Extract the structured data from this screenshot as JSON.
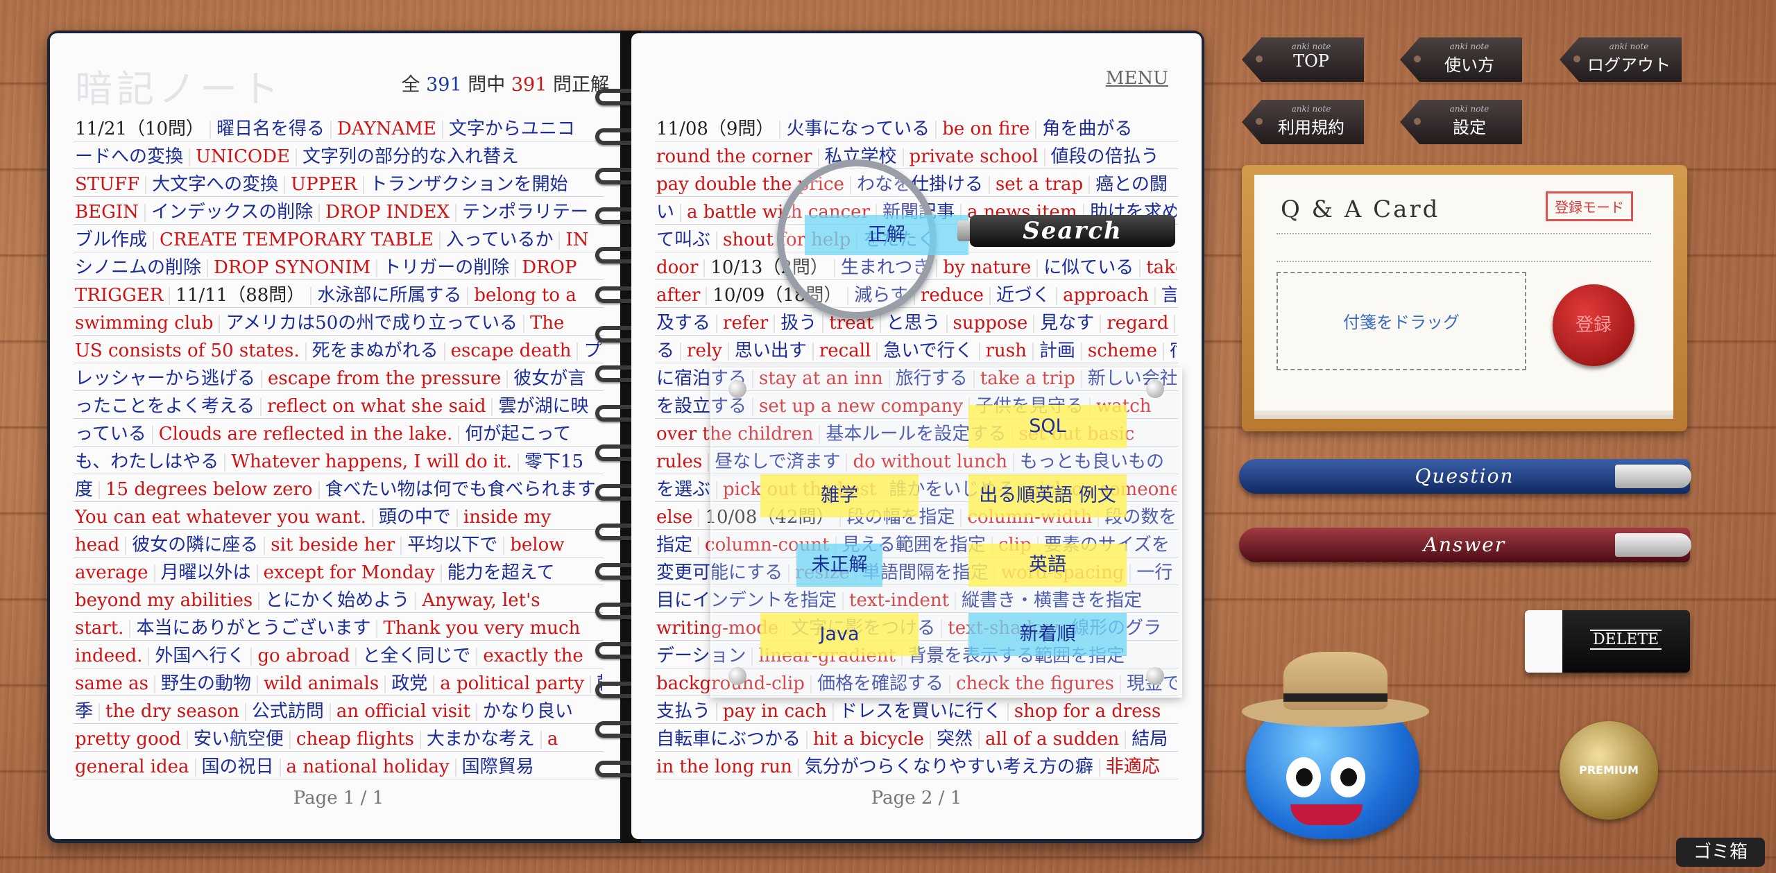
{
  "notebook": {
    "title": "暗記ノート",
    "score": {
      "prefix": "全",
      "total": "391",
      "mid": "問中",
      "correct": "391",
      "suffix": "問正解"
    },
    "menu": "MENU",
    "left_page_label": "Page 1 / 1",
    "right_page_label": "Page 2 / 1",
    "left_lines": [
      [
        [
          "d",
          "11/21（10問）"
        ],
        [
          "q",
          "曜日名を得る"
        ],
        [
          "a",
          "DAYNAME"
        ],
        [
          "q",
          "文字からユニコ"
        ]
      ],
      [
        [
          "q",
          "ードへの変換"
        ],
        [
          "a",
          "UNICODE"
        ],
        [
          "q",
          "文字列の部分的な入れ替え"
        ]
      ],
      [
        [
          "a",
          "STUFF"
        ],
        [
          "q",
          "大文字への変換"
        ],
        [
          "a",
          "UPPER"
        ],
        [
          "q",
          "トランザクションを開始"
        ]
      ],
      [
        [
          "a",
          "BEGIN"
        ],
        [
          "q",
          "インデックスの削除"
        ],
        [
          "a",
          "DROP INDEX"
        ],
        [
          "q",
          "テンポラリテー"
        ]
      ],
      [
        [
          "q",
          "ブル作成"
        ],
        [
          "a",
          "CREATE TEMPORARY TABLE"
        ],
        [
          "q",
          "入っているか"
        ],
        [
          "a",
          "IN"
        ]
      ],
      [
        [
          "q",
          "シノニムの削除"
        ],
        [
          "a",
          "DROP SYNONIM"
        ],
        [
          "q",
          "トリガーの削除"
        ],
        [
          "a",
          "DROP"
        ]
      ],
      [
        [
          "a",
          "TRIGGER"
        ],
        [
          "d",
          "11/11（88問）"
        ],
        [
          "q",
          "水泳部に所属する"
        ],
        [
          "a",
          "belong to a"
        ]
      ],
      [
        [
          "a",
          "swimming club"
        ],
        [
          "q",
          "アメリカは50の州で成り立っている"
        ],
        [
          "a",
          "The"
        ]
      ],
      [
        [
          "a",
          "US consists of 50 states."
        ],
        [
          "q",
          "死をまぬがれる"
        ],
        [
          "a",
          "escape death"
        ],
        [
          "q",
          "プ"
        ]
      ],
      [
        [
          "q",
          "レッシャーから逃げる"
        ],
        [
          "a",
          "escape from the pressure"
        ],
        [
          "q",
          "彼女が言"
        ]
      ],
      [
        [
          "q",
          "ったことをよく考える"
        ],
        [
          "a",
          "reflect on what she said"
        ],
        [
          "q",
          "雲が湖に映"
        ]
      ],
      [
        [
          "q",
          "っている"
        ],
        [
          "a",
          "Clouds are reflected in the lake."
        ],
        [
          "q",
          "何が起こって"
        ]
      ],
      [
        [
          "q",
          "も、わたしはやる"
        ],
        [
          "a",
          "Whatever happens, I will do it."
        ],
        [
          "q",
          "零下15"
        ]
      ],
      [
        [
          "q",
          "度"
        ],
        [
          "a",
          "15 degrees below zero"
        ],
        [
          "q",
          "食べたい物は何でも食べられます"
        ]
      ],
      [
        [
          "a",
          "You can eat whatever you want."
        ],
        [
          "q",
          "頭の中で"
        ],
        [
          "a",
          "inside my"
        ]
      ],
      [
        [
          "a",
          "head"
        ],
        [
          "q",
          "彼女の隣に座る"
        ],
        [
          "a",
          "sit beside her"
        ],
        [
          "q",
          "平均以下で"
        ],
        [
          "a",
          "below"
        ]
      ],
      [
        [
          "a",
          "average"
        ],
        [
          "q",
          "月曜以外は"
        ],
        [
          "a",
          "except for Monday"
        ],
        [
          "q",
          "能力を超えて"
        ]
      ],
      [
        [
          "a",
          "beyond my abilities"
        ],
        [
          "q",
          "とにかく始めよう"
        ],
        [
          "a",
          "Anyway, let's"
        ]
      ],
      [
        [
          "a",
          "start."
        ],
        [
          "q",
          "本当にありがとうございます"
        ],
        [
          "a",
          "Thank you very much"
        ]
      ],
      [
        [
          "a",
          "indeed."
        ],
        [
          "q",
          "外国へ行く"
        ],
        [
          "a",
          "go abroad"
        ],
        [
          "q",
          "と全く同じで"
        ],
        [
          "a",
          "exactly the"
        ]
      ],
      [
        [
          "a",
          "same as"
        ],
        [
          "q",
          "野生の動物"
        ],
        [
          "a",
          "wild animals"
        ],
        [
          "q",
          "政党"
        ],
        [
          "a",
          "a political party"
        ],
        [
          "q",
          "乾"
        ]
      ],
      [
        [
          "q",
          "季"
        ],
        [
          "a",
          "the dry season"
        ],
        [
          "q",
          "公式訪問"
        ],
        [
          "a",
          "an official visit"
        ],
        [
          "q",
          "かなり良い"
        ]
      ],
      [
        [
          "a",
          "pretty good"
        ],
        [
          "q",
          "安い航空便"
        ],
        [
          "a",
          "cheap flights"
        ],
        [
          "q",
          "大まかな考え"
        ],
        [
          "a",
          "a"
        ]
      ],
      [
        [
          "a",
          "general idea"
        ],
        [
          "q",
          "国の祝日"
        ],
        [
          "a",
          "a national holiday"
        ],
        [
          "q",
          "国際貿易"
        ]
      ]
    ],
    "right_lines": [
      [
        [
          "d",
          "11/08（9問）"
        ],
        [
          "q",
          "火事になっている"
        ],
        [
          "a",
          "be on fire"
        ],
        [
          "q",
          "角を曲がる"
        ]
      ],
      [
        [
          "a",
          "round the corner"
        ],
        [
          "q",
          "私立学校"
        ],
        [
          "a",
          "private school"
        ],
        [
          "q",
          "値段の倍払う"
        ]
      ],
      [
        [
          "a",
          "pay double the price"
        ],
        [
          "q",
          "わなを仕掛ける"
        ],
        [
          "a",
          "set a trap"
        ],
        [
          "q",
          "癌との闘"
        ]
      ],
      [
        [
          "q",
          "い"
        ],
        [
          "a",
          "a battle with cancer"
        ],
        [
          "q",
          "新聞記事"
        ],
        [
          "a",
          "a news item"
        ],
        [
          "q",
          "助けを求め"
        ]
      ],
      [
        [
          "q",
          "て叫ぶ"
        ],
        [
          "a",
          "shout for help"
        ],
        [
          "q",
          "をたたく"
        ]
      ],
      [
        [
          "a",
          "door"
        ],
        [
          "d",
          "10/13（2問）"
        ],
        [
          "q",
          "生まれつき"
        ],
        [
          "a",
          "by nature"
        ],
        [
          "q",
          "に似ている"
        ],
        [
          "a",
          "take"
        ]
      ],
      [
        [
          "a",
          "after"
        ],
        [
          "d",
          "10/09（18問）"
        ],
        [
          "q",
          "減らす"
        ],
        [
          "a",
          "reduce"
        ],
        [
          "q",
          "近づく"
        ],
        [
          "a",
          "approach"
        ],
        [
          "q",
          "言"
        ]
      ],
      [
        [
          "q",
          "及する"
        ],
        [
          "a",
          "refer"
        ],
        [
          "q",
          "扱う"
        ],
        [
          "a",
          "treat"
        ],
        [
          "q",
          "と思う"
        ],
        [
          "a",
          "suppose"
        ],
        [
          "q",
          "見なす"
        ],
        [
          "a",
          "regard"
        ],
        [
          "q",
          "頼"
        ]
      ],
      [
        [
          "q",
          "る"
        ],
        [
          "a",
          "rely"
        ],
        [
          "q",
          "思い出す"
        ],
        [
          "a",
          "recall"
        ],
        [
          "q",
          "急いで行く"
        ],
        [
          "a",
          "rush"
        ],
        [
          "q",
          "計画"
        ],
        [
          "a",
          "scheme"
        ],
        [
          "q",
          "宿"
        ]
      ],
      [
        [
          "q",
          "に宿泊する"
        ],
        [
          "a",
          "stay at an inn"
        ],
        [
          "q",
          "旅行する"
        ],
        [
          "a",
          "take a trip"
        ],
        [
          "q",
          "新しい会社"
        ]
      ],
      [
        [
          "q",
          "を設立する"
        ],
        [
          "a",
          "set up a new company"
        ],
        [
          "q",
          "子供を見守る"
        ],
        [
          "a",
          "watch"
        ]
      ],
      [
        [
          "a",
          "over the children"
        ],
        [
          "q",
          "基本ルールを設定する"
        ],
        [
          "a",
          "set out basic"
        ]
      ],
      [
        [
          "a",
          "rules"
        ],
        [
          "q",
          "昼なしで済ます"
        ],
        [
          "a",
          "do without lunch"
        ],
        [
          "q",
          "もっとも良いもの"
        ]
      ],
      [
        [
          "q",
          "を選ぶ"
        ],
        [
          "a",
          "pick out the best"
        ],
        [
          "q",
          "誰かをいじめる"
        ],
        [
          "a",
          "pick on someone"
        ]
      ],
      [
        [
          "a",
          "else"
        ],
        [
          "d",
          "10/08（42問）"
        ],
        [
          "q",
          "段の幅を指定"
        ],
        [
          "a",
          "column-width"
        ],
        [
          "q",
          "段の数を"
        ]
      ],
      [
        [
          "q",
          "指定"
        ],
        [
          "a",
          "column-count"
        ],
        [
          "q",
          "見える範囲を指定"
        ],
        [
          "a",
          "clip"
        ],
        [
          "q",
          "要素のサイズを"
        ]
      ],
      [
        [
          "q",
          "変更可能にする"
        ],
        [
          "a",
          "resize"
        ],
        [
          "q",
          "単語間隔を指定"
        ],
        [
          "a",
          "word-spacing"
        ],
        [
          "q",
          "一行"
        ]
      ],
      [
        [
          "q",
          "目にインデントを指定"
        ],
        [
          "a",
          "text-indent"
        ],
        [
          "q",
          "縦書き・横書きを指定"
        ]
      ],
      [
        [
          "a",
          "writing-mode"
        ],
        [
          "q",
          "文字に影をつける"
        ],
        [
          "a",
          "text-shadow"
        ],
        [
          "q",
          "線形のグラ"
        ]
      ],
      [
        [
          "q",
          "デーション"
        ],
        [
          "a",
          "linear-gradient"
        ],
        [
          "q",
          "背景を表示する範囲を指定"
        ]
      ],
      [
        [
          "a",
          "background-clip"
        ],
        [
          "q",
          "価格を確認する"
        ],
        [
          "a",
          "check the figures"
        ],
        [
          "q",
          "現金で"
        ]
      ],
      [
        [
          "q",
          "支払う"
        ],
        [
          "a",
          "pay in cach"
        ],
        [
          "q",
          "ドレスを買いに行く"
        ],
        [
          "a",
          "shop for a dress"
        ]
      ],
      [
        [
          "q",
          "自転車にぶつかる"
        ],
        [
          "a",
          "hit a bicycle"
        ],
        [
          "q",
          "突然"
        ],
        [
          "a",
          "all of a sudden"
        ],
        [
          "q",
          "結局"
        ]
      ],
      [
        [
          "a",
          "in the long run"
        ],
        [
          "q",
          "気分がつらくなりやすい考え方の癖"
        ],
        [
          "a",
          "非適応"
        ]
      ]
    ]
  },
  "search": {
    "label": "Search",
    "filter_label": "正解"
  },
  "filters": [
    {
      "label": "SQL",
      "color": "yellow"
    },
    {
      "label": "雑学",
      "color": "yellow"
    },
    {
      "label": "出る順英語 例文",
      "color": "yellow"
    },
    {
      "label": "未正解",
      "color": "cyan"
    },
    {
      "label": "英語",
      "color": "yellow"
    },
    {
      "label": "Java",
      "color": "yellow"
    },
    {
      "label": "新着順",
      "color": "cyan"
    }
  ],
  "nav": {
    "tag_caption": "anki note",
    "items": [
      "TOP",
      "使い方",
      "ログアウト",
      "利用規約",
      "設定"
    ]
  },
  "card": {
    "title": "Q & A Card",
    "mode_stamp": "登録モード",
    "dropzone_text": "付箋をドラッグ",
    "register_seal": "登録"
  },
  "pens": {
    "question": "Question",
    "answer": "Answer"
  },
  "eraser": {
    "label": "DELETE"
  },
  "premium": {
    "label": "PREMIUM"
  },
  "trash": {
    "label": "ゴミ箱"
  },
  "colors": {
    "question_text": "#1b2d9c",
    "answer_text": "#d11212",
    "tag_yellow": "#fff25a",
    "tag_cyan": "#6ed7f5"
  },
  "icons": [
    "magnifier-icon",
    "wax-seal-icon",
    "slime-mascot-icon",
    "premium-badge-icon",
    "eraser-icon",
    "pen-icon"
  ]
}
